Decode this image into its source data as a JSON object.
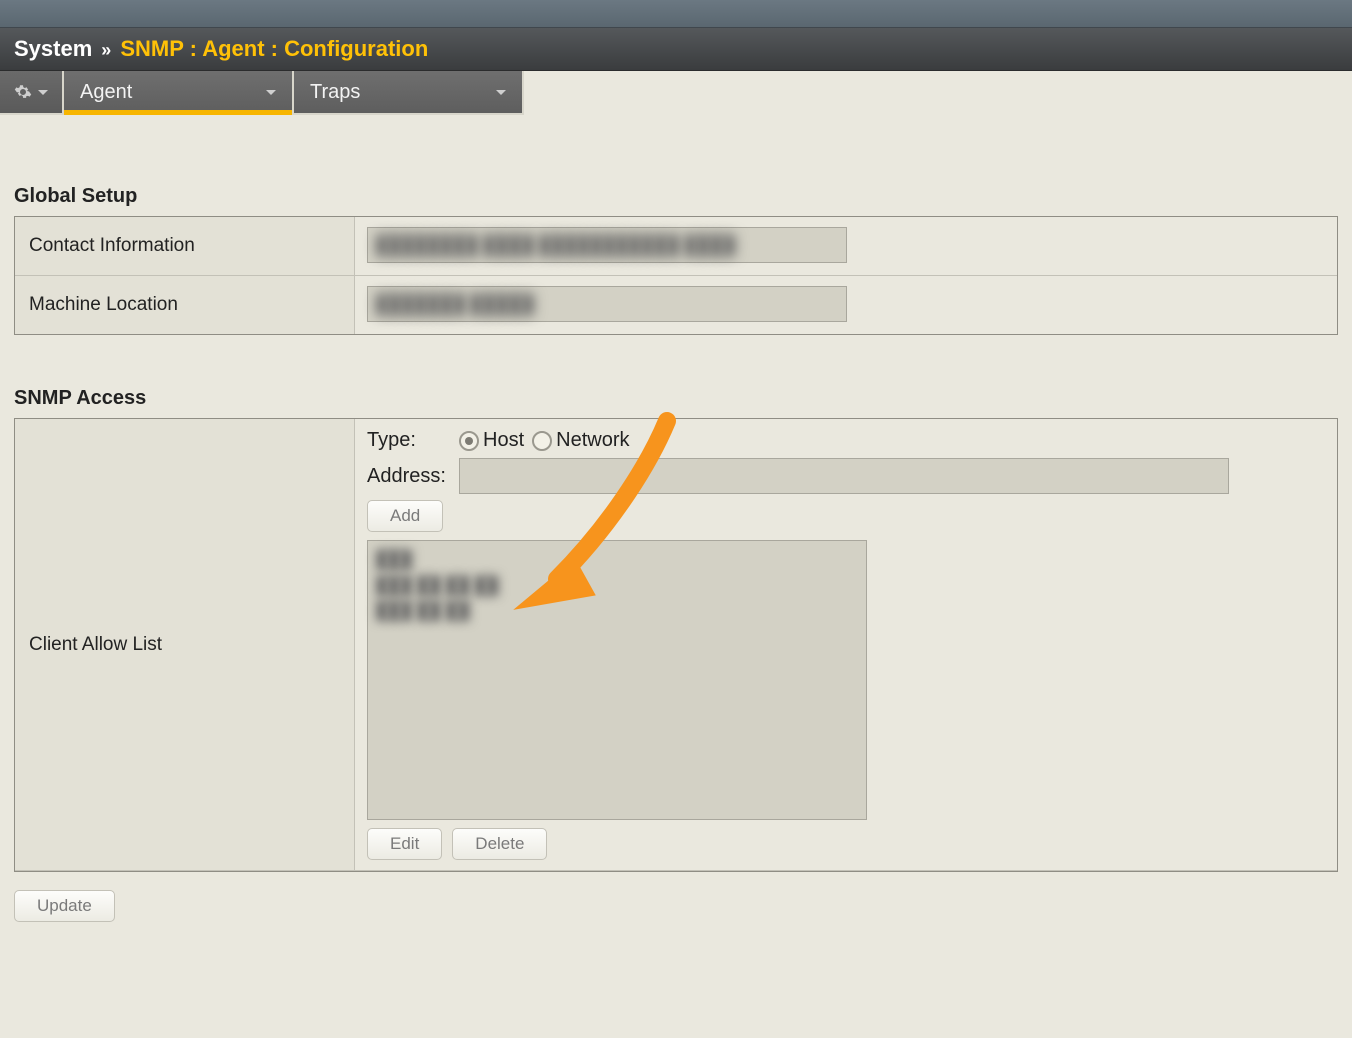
{
  "breadcrumb": {
    "prefix": "System",
    "separator": "»",
    "path": "SNMP : Agent : Configuration"
  },
  "tabs": [
    {
      "label": "Agent",
      "active": true
    },
    {
      "label": "Traps",
      "active": false
    }
  ],
  "sections": {
    "global_setup": {
      "title": "Global Setup",
      "contact_label": "Contact Information",
      "contact_value": "████████ ████ ███████████ ████",
      "location_label": "Machine Location",
      "location_value": "███████ █████"
    },
    "snmp_access": {
      "title": "SNMP Access",
      "client_allow_label": "Client Allow List",
      "type_label": "Type:",
      "type_options": {
        "host": "Host",
        "network": "Network"
      },
      "type_selected": "host",
      "address_label": "Address:",
      "address_value": "",
      "add_label": "Add",
      "list_items": [
        "███",
        "███ ██ ██ ██",
        "███ ██ ██"
      ],
      "edit_label": "Edit",
      "delete_label": "Delete"
    }
  },
  "footer": {
    "update_label": "Update"
  },
  "arrow": {
    "color": "#f7941d"
  }
}
